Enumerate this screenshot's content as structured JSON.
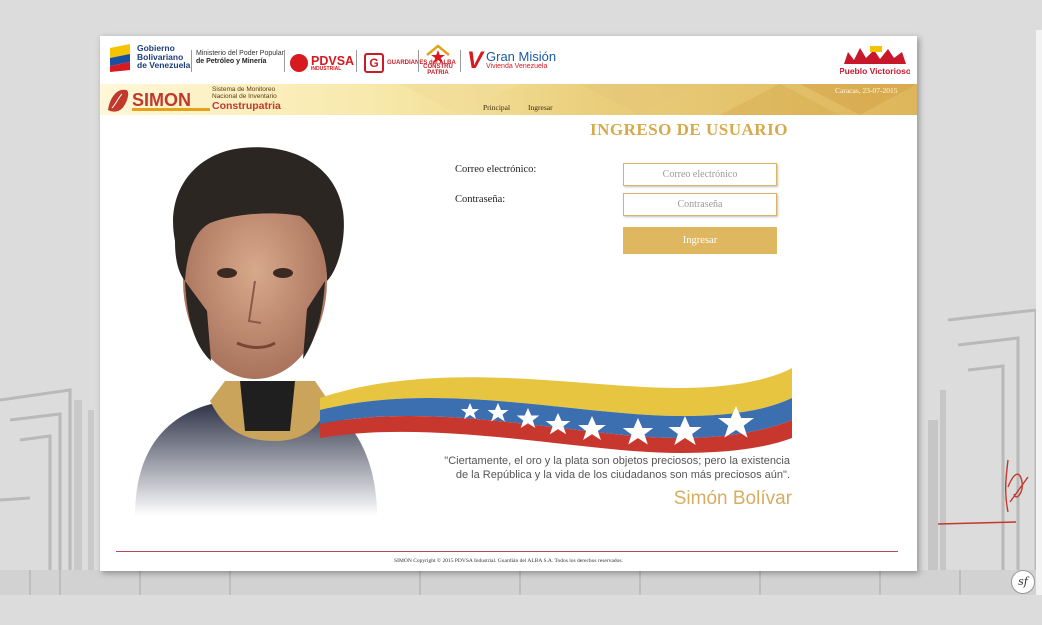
{
  "header": {
    "gobierno_lines": [
      "Gobierno",
      "Bolivariano",
      "de Venezuela"
    ],
    "ministerio_lines": [
      "Ministerio del Poder Popular",
      "de Petróleo y Minería"
    ],
    "pdvsa_label": "PDVSA",
    "pdvsa_sub": "INDUSTRIAL",
    "guardianes_label": "GUARDIANES del ALBA",
    "patria_label": "CONSTRU PATRIA",
    "gmvv_title": "Gran Misión",
    "gmvv_sub": "Vivienda Venezuela",
    "pueblo_label": "Pueblo Victorioso"
  },
  "banner": {
    "simon_logo": "SIMON",
    "simon_sub_lines": [
      "Sistema de Monitoreo",
      "Nacional de Inventario"
    ],
    "construpatria": "Construpatria",
    "nav": [
      {
        "label": "Principal"
      },
      {
        "label": "Ingresar"
      }
    ],
    "date": "Caracas, 23-07-2015"
  },
  "login": {
    "title": "INGRESO DE USUARIO",
    "email_label": "Correo electrónico:",
    "email_placeholder": "Correo electrónico",
    "password_label": "Contraseña:",
    "password_placeholder": "Contraseña",
    "submit_label": "Ingresar"
  },
  "quote": {
    "text_line1": "\"Ciertamente, el oro y la plata son objetos preciosos; pero la existencia",
    "text_line2": "de la República y la vida de los ciudadanos son más preciosos aún\".",
    "author": "Simón Bolívar"
  },
  "footer": {
    "text": "SIMON Copyright © 2015 PDVSA Industrial. Guardián del ALBA S.A. Todos los derechos reservados."
  },
  "badge": {
    "label": "sf"
  },
  "colors": {
    "accent_gold": "#dfb760",
    "title_gold": "#d6a94a",
    "flag_yellow": "#e8c540",
    "flag_blue": "#3b6fb0",
    "flag_red": "#c8372e"
  }
}
